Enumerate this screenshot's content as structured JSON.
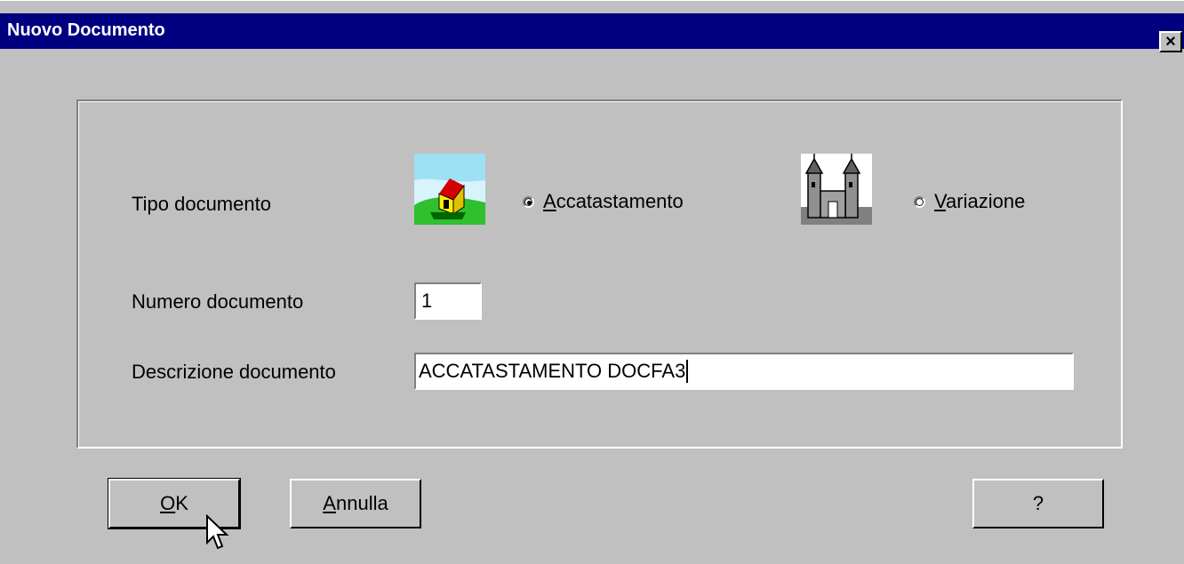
{
  "window": {
    "title": "Nuovo Documento",
    "close_label": "×"
  },
  "form": {
    "tipo_label": "Tipo documento",
    "options": [
      {
        "label": "Accatastamento",
        "checked": true,
        "icon": "house-icon"
      },
      {
        "label": "Variazione",
        "checked": false,
        "icon": "castle-icon"
      }
    ],
    "numero_label": "Numero documento",
    "numero_value": "1",
    "descrizione_label": "Descrizione documento",
    "descrizione_value": "ACCATASTAMENTO DOCFA3"
  },
  "buttons": {
    "ok": "OK",
    "annulla": "Annulla",
    "help": "?"
  }
}
